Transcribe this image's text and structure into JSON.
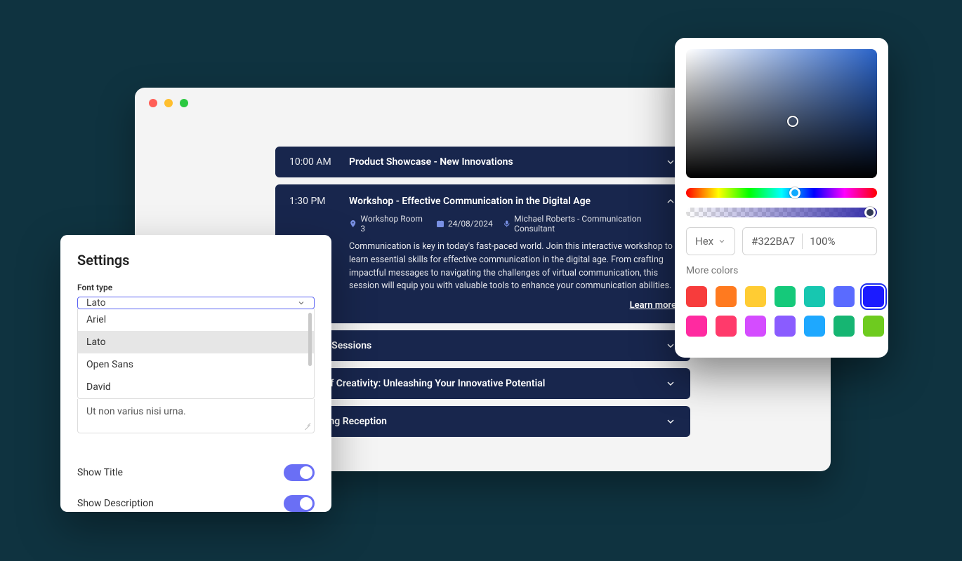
{
  "window": {
    "agenda": [
      {
        "time": "10:00 AM",
        "title": "Product Showcase - New Innovations",
        "expanded": false
      },
      {
        "time": "1:30 PM",
        "title": "Workshop - Effective Communication in the Digital Age",
        "expanded": true,
        "location": "Workshop Room 3",
        "date": "24/08/2024",
        "speaker": "Michael Roberts - Communication Consultant",
        "description": "Communication is key in today's fast-paced world. Join this interactive workshop to learn essential skills for effective communication in the digital age. From crafting impactful messages to navigating the challenges of virtual communication, this session will equip you with valuable tools to enhance your communication abilities.",
        "learn_more": "Learn more"
      },
      {
        "time": "",
        "title": "Breakout Sessions",
        "expanded": false
      },
      {
        "time": "",
        "title": "The Art of Creativity: Unleashing Your Innovative Potential",
        "expanded": false
      },
      {
        "time": "",
        "title": "Networking Reception",
        "expanded": false
      }
    ]
  },
  "settings": {
    "title": "Settings",
    "font_type_label": "Font type",
    "selected_font": "Lato",
    "options": [
      "Ariel",
      "Lato",
      "Open Sans",
      "David"
    ],
    "textarea_value": "Ut non varius nisi urna.",
    "show_title_label": "Show Title",
    "show_description_label": "Show Description",
    "show_title": true,
    "show_description": true
  },
  "picker": {
    "format": "Hex",
    "hex": "#322BA7",
    "alpha": "100%",
    "more_colors_label": "More colors",
    "swatches": [
      "#f73c3c",
      "#ff7a1f",
      "#ffcc33",
      "#15c97a",
      "#17c7b0",
      "#5a6bff",
      "#1b1bff",
      "#ff2aa0",
      "#ff3a6b",
      "#d44cff",
      "#8a5cff",
      "#1ea8ff",
      "#16b572",
      "#6ecb1f"
    ],
    "selected_swatch_index": 6
  }
}
